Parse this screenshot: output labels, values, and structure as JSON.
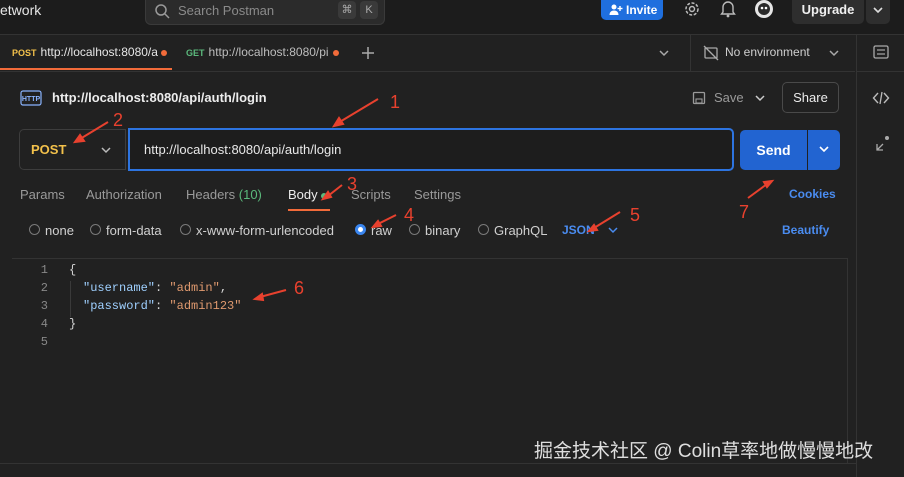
{
  "topbar": {
    "brand": "etwork",
    "search_placeholder": "Search Postman",
    "kbd1": "⌘",
    "kbd2": "K",
    "invite_label": "Invite",
    "upgrade_label": "Upgrade"
  },
  "tabs": [
    {
      "method": "POST",
      "method_color": "#f3c14b",
      "url": "http://localhost:8080/a"
    },
    {
      "method": "GET",
      "method_color": "#5bb97c",
      "url": "http://localhost:8080/pi"
    }
  ],
  "environment": "No environment",
  "request": {
    "title": "http://localhost:8080/api/auth/login",
    "save_label": "Save",
    "share_label": "Share",
    "method": "POST",
    "url": "http://localhost:8080/api/auth/login",
    "send_label": "Send"
  },
  "request_tabs": {
    "params": "Params",
    "authorization": "Authorization",
    "headers": "Headers",
    "headers_count": "(10)",
    "body": "Body",
    "scripts": "Scripts",
    "settings": "Settings",
    "cookies": "Cookies"
  },
  "body_options": {
    "none": "none",
    "form_data": "form-data",
    "urlencoded": "x-www-form-urlencoded",
    "raw": "raw",
    "binary": "binary",
    "graphql": "GraphQL",
    "format": "JSON",
    "beautify": "Beautify"
  },
  "editor": {
    "line_numbers": [
      "1",
      "2",
      "3",
      "4",
      "5"
    ],
    "open_brace": "{",
    "key1": "\"username\"",
    "val1": "\"admin\"",
    "key2": "\"password\"",
    "val2": "\"admin123\"",
    "close_brace": "}"
  },
  "annotations": [
    "1",
    "2",
    "3",
    "4",
    "5",
    "6",
    "7"
  ],
  "watermark": "掘金技术社区 @ Colin草率地做慢慢地改",
  "colors": {
    "accent_blue": "#2264d1",
    "annotation_red": "#e8412e",
    "post_method": "#f3c14b"
  }
}
